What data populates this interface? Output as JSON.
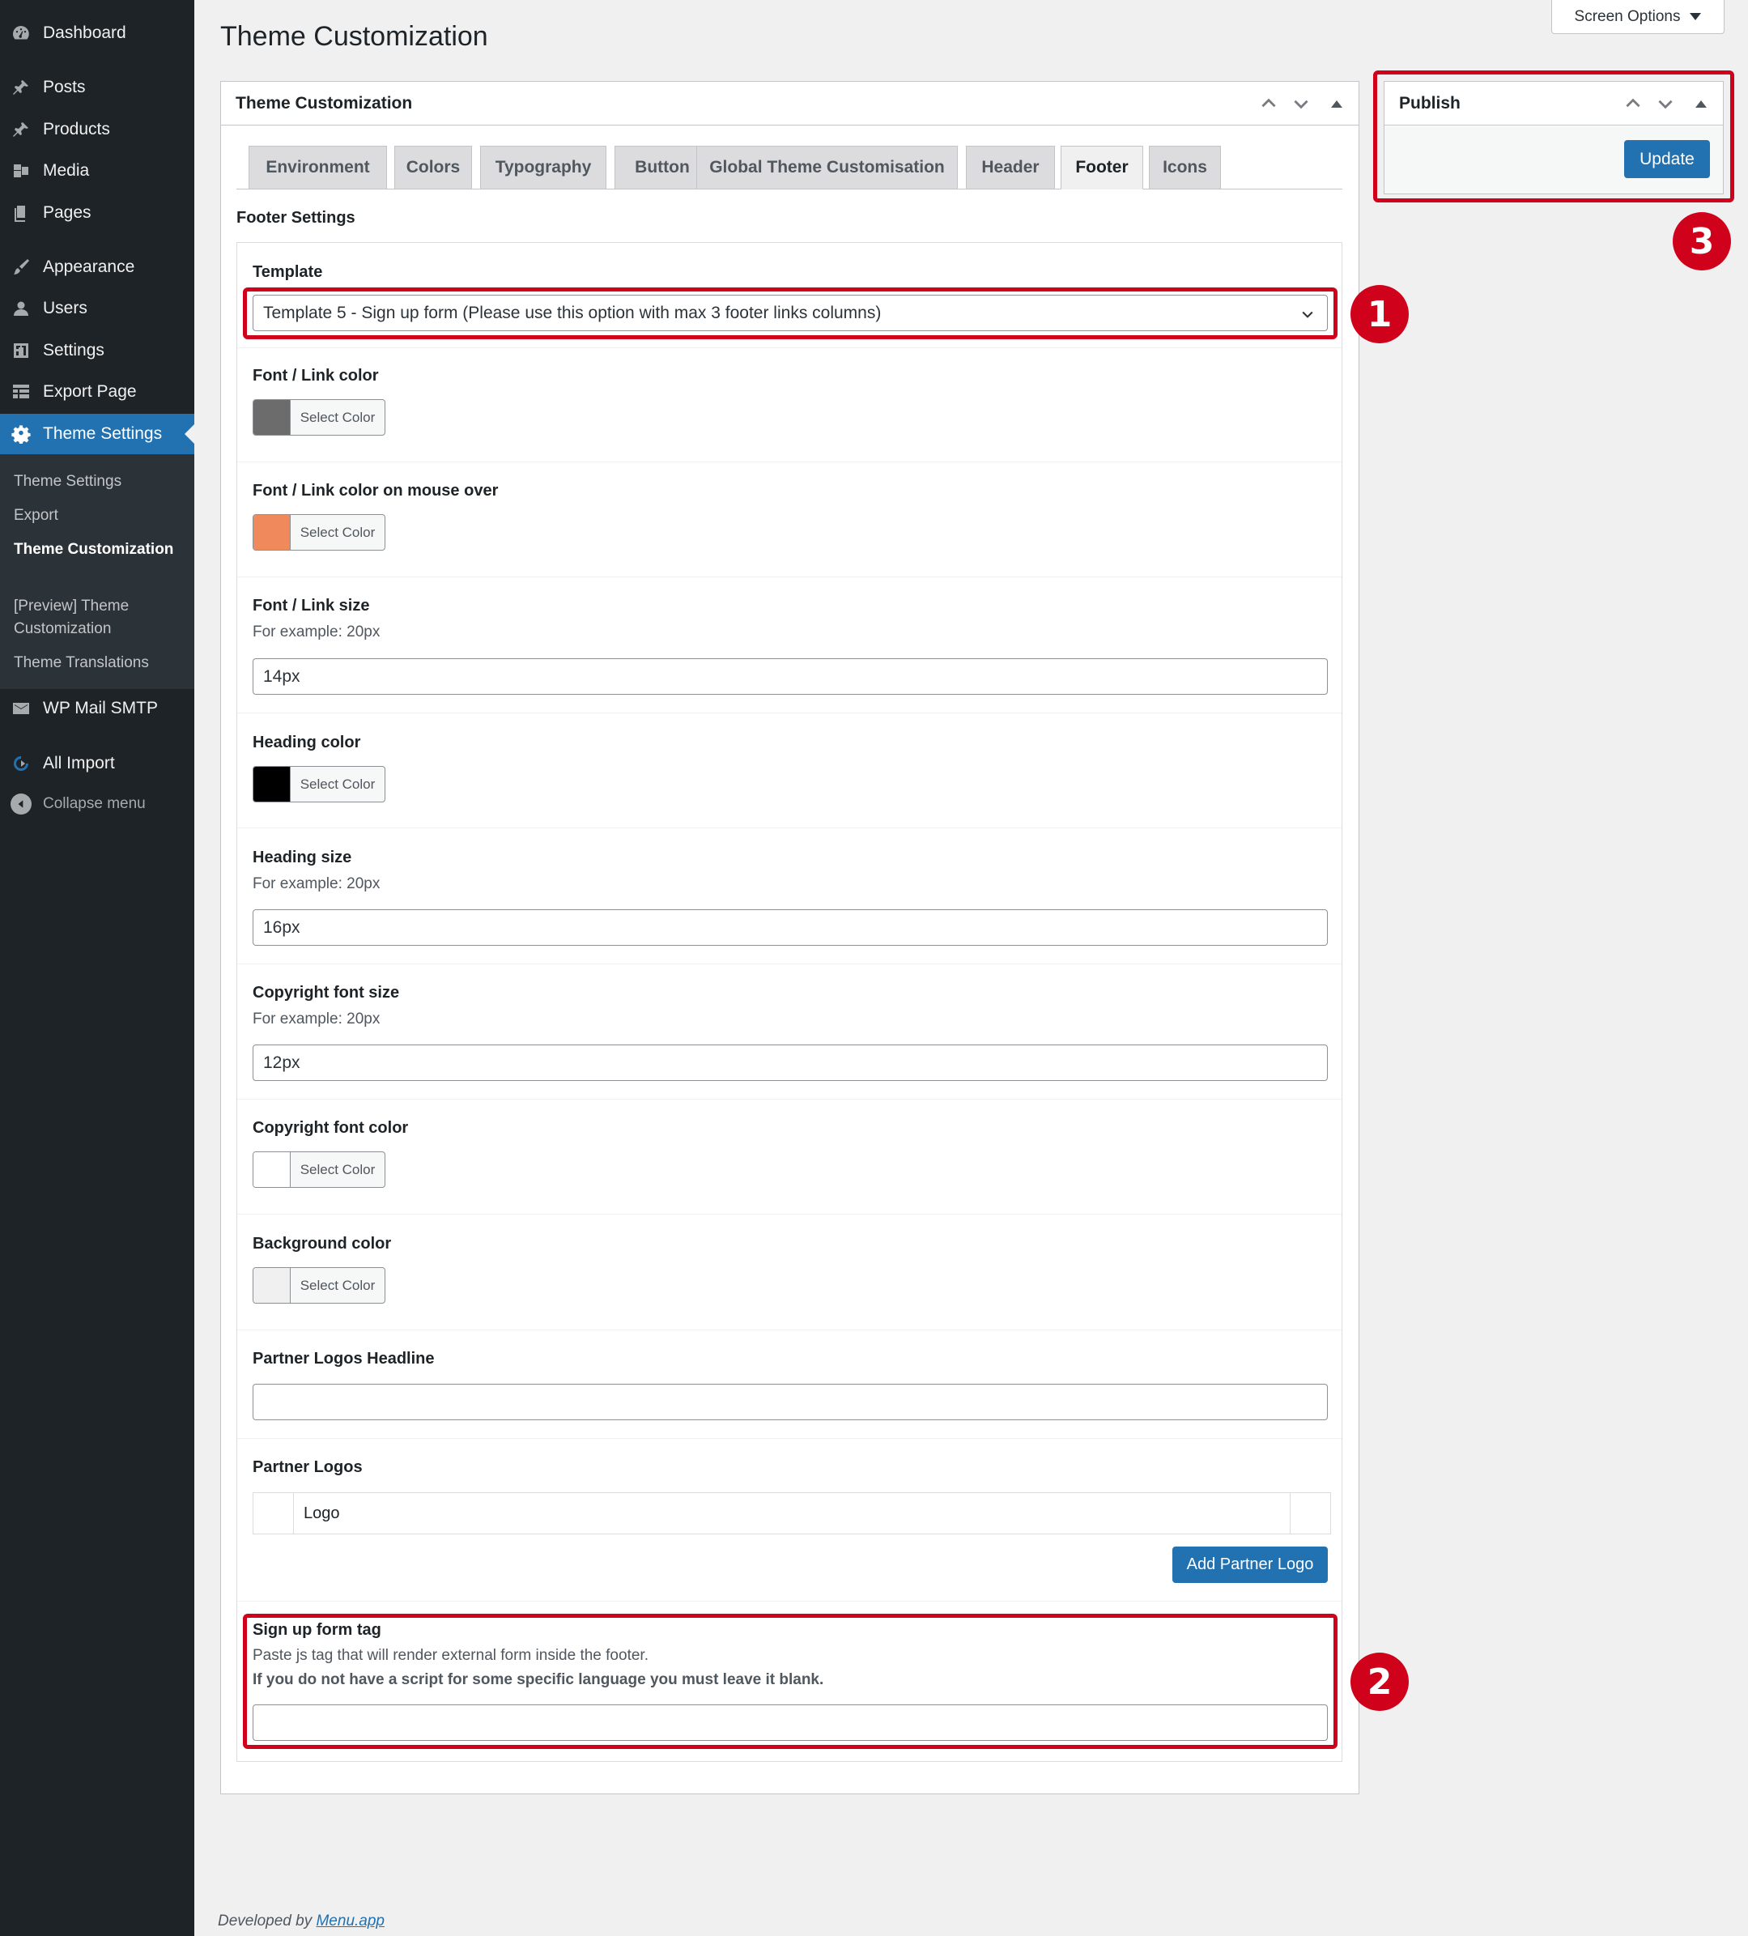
{
  "sidebar": {
    "items": [
      {
        "label": "Dashboard",
        "icon": "dashboard-icon"
      },
      {
        "label": "Posts",
        "icon": "pin-icon"
      },
      {
        "label": "Products",
        "icon": "pin-icon"
      },
      {
        "label": "Media",
        "icon": "media-icon"
      },
      {
        "label": "Pages",
        "icon": "page-icon"
      },
      {
        "label": "Appearance",
        "icon": "brush-icon"
      },
      {
        "label": "Users",
        "icon": "user-icon"
      },
      {
        "label": "Settings",
        "icon": "settings-icon"
      },
      {
        "label": "Export Page",
        "icon": "table-icon"
      },
      {
        "label": "Theme Settings",
        "icon": "gear-icon"
      },
      {
        "label": "WP Mail SMTP",
        "icon": "mail-icon"
      },
      {
        "label": "All Import",
        "icon": "import-icon"
      }
    ],
    "submenu": [
      {
        "label": "Theme Settings"
      },
      {
        "label": "Export"
      },
      {
        "label": "Theme Customization"
      },
      {
        "label": "[Preview] Theme Customization"
      },
      {
        "label": "Theme Translations"
      }
    ],
    "collapse_label": "Collapse menu"
  },
  "header": {
    "title": "Theme Customization",
    "screen_options": "Screen Options"
  },
  "main_box": {
    "title": "Theme Customization",
    "tabs": [
      {
        "label": "Environment"
      },
      {
        "label": "Colors"
      },
      {
        "label": "Typography"
      },
      {
        "label": "Button"
      },
      {
        "label": "Global Theme Customisation"
      },
      {
        "label": "Header"
      },
      {
        "label": "Footer"
      },
      {
        "label": "Icons"
      }
    ],
    "active_tab": "Footer",
    "section_title": "Footer Settings"
  },
  "fields": {
    "template": {
      "label": "Template",
      "value": "Template 5 - Sign up form (Please use this option with max 3 footer links columns)"
    },
    "font_link_color": {
      "label": "Font / Link color",
      "button": "Select Color",
      "color": "#6c6c6c"
    },
    "font_link_hover": {
      "label": "Font / Link color on mouse over",
      "button": "Select Color",
      "color": "#f08a5d"
    },
    "font_link_size": {
      "label": "Font / Link size",
      "desc": "For example: 20px",
      "value": "14px"
    },
    "heading_color": {
      "label": "Heading color",
      "button": "Select Color",
      "color": "#000000"
    },
    "heading_size": {
      "label": "Heading size",
      "desc": "For example: 20px",
      "value": "16px"
    },
    "copyright_size": {
      "label": "Copyright font size",
      "desc": "For example: 20px",
      "value": "12px"
    },
    "copyright_color": {
      "label": "Copyright font color",
      "button": "Select Color",
      "color": "#ffffff"
    },
    "background_color": {
      "label": "Background color",
      "button": "Select Color",
      "color": "#f0f0f1"
    },
    "partner_headline": {
      "label": "Partner Logos Headline",
      "value": ""
    },
    "partner_logos": {
      "label": "Partner Logos",
      "column": "Logo",
      "add_button": "Add Partner Logo"
    },
    "signup_tag": {
      "label": "Sign up form tag",
      "desc": "Paste js tag that will render external form inside the footer.",
      "note": "If you do not have a script for some specific language you must leave it blank.",
      "value": ""
    }
  },
  "publish": {
    "title": "Publish",
    "update_button": "Update"
  },
  "annotations": {
    "one": "1",
    "two": "2",
    "three": "3",
    "color": "#d0021b"
  },
  "footer": {
    "prefix": "Developed by",
    "link": "Menu.app"
  },
  "colors": {
    "accent": "#2271b1",
    "sidebar_bg": "#1d2327"
  }
}
